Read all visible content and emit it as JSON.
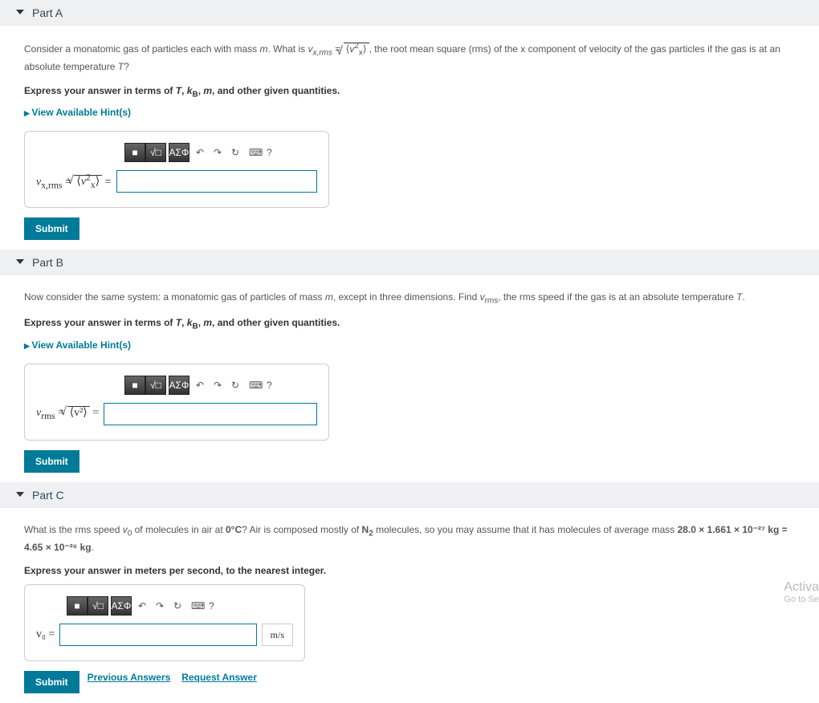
{
  "partA": {
    "title": "Part A",
    "question_pre": "Consider a monatomic gas of particles each with mass ",
    "m": "m",
    "question_mid1": ". What is ",
    "vxrms": "v",
    "question_mid2": ", the root mean square (rms) of the x component of velocity of the gas particles if the gas is at an absolute temperature ",
    "T": "T",
    "question_end": "?",
    "instr": "Express your answer in terms of T, k_B, m, and other given quantities.",
    "hints": "View Available Hint(s)",
    "lhs_label": "v",
    "lhs_sub": "x,rms",
    "sqrt_inner_pre": "⟨v",
    "sqrt_inner_sup": "2",
    "sqrt_inner_sub": "x",
    "sqrt_inner_post": "⟩",
    "submit": "Submit"
  },
  "partB": {
    "title": "Part B",
    "question_pre": "Now consider the same system: a monatomic gas of particles of mass ",
    "m": "m",
    "question_mid1": ", except in three dimensions. Find ",
    "vrms": "v",
    "vrms_sub": "rms",
    "question_mid2": ", the rms speed if the gas is at an absolute temperature ",
    "T": "T",
    "question_end": ".",
    "instr": "Express your answer in terms of T, k_B, m, and other given quantities.",
    "hints": "View Available Hint(s)",
    "lhs_label": "v",
    "lhs_sub": "rms",
    "sqrt_inner": "⟨v²⟩",
    "submit": "Submit"
  },
  "partC": {
    "title": "Part C",
    "question_pre": "What is the rms speed ",
    "v0": "v",
    "v0_sub": "0",
    "question_mid1": " of molecules in air at ",
    "temp": "0°C",
    "question_mid2": "? Air is composed mostly of ",
    "N2": "N",
    "N2_sub": "2",
    "question_mid3": " molecules, so you may assume that it has molecules of average mass ",
    "mass_expr": "28.0 × 1.661 × 10⁻²⁷ kg = 4.65 × 10⁻²⁶ kg",
    "question_end": ".",
    "instr": "Express your answer in meters per second, to the nearest integer.",
    "lhs": "v₀ =",
    "unit": "m/s",
    "submit": "Submit",
    "prev": "Previous Answers",
    "req": "Request Answer"
  },
  "toolbar": {
    "templates": "■",
    "frac": "√□",
    "greek": "ΑΣΦ",
    "undo": "↶",
    "redo": "↷",
    "reset": "↻",
    "keyboard": "⌨",
    "help": "?"
  },
  "watermark": {
    "l1": "Activa",
    "l2": "Go to Se"
  }
}
